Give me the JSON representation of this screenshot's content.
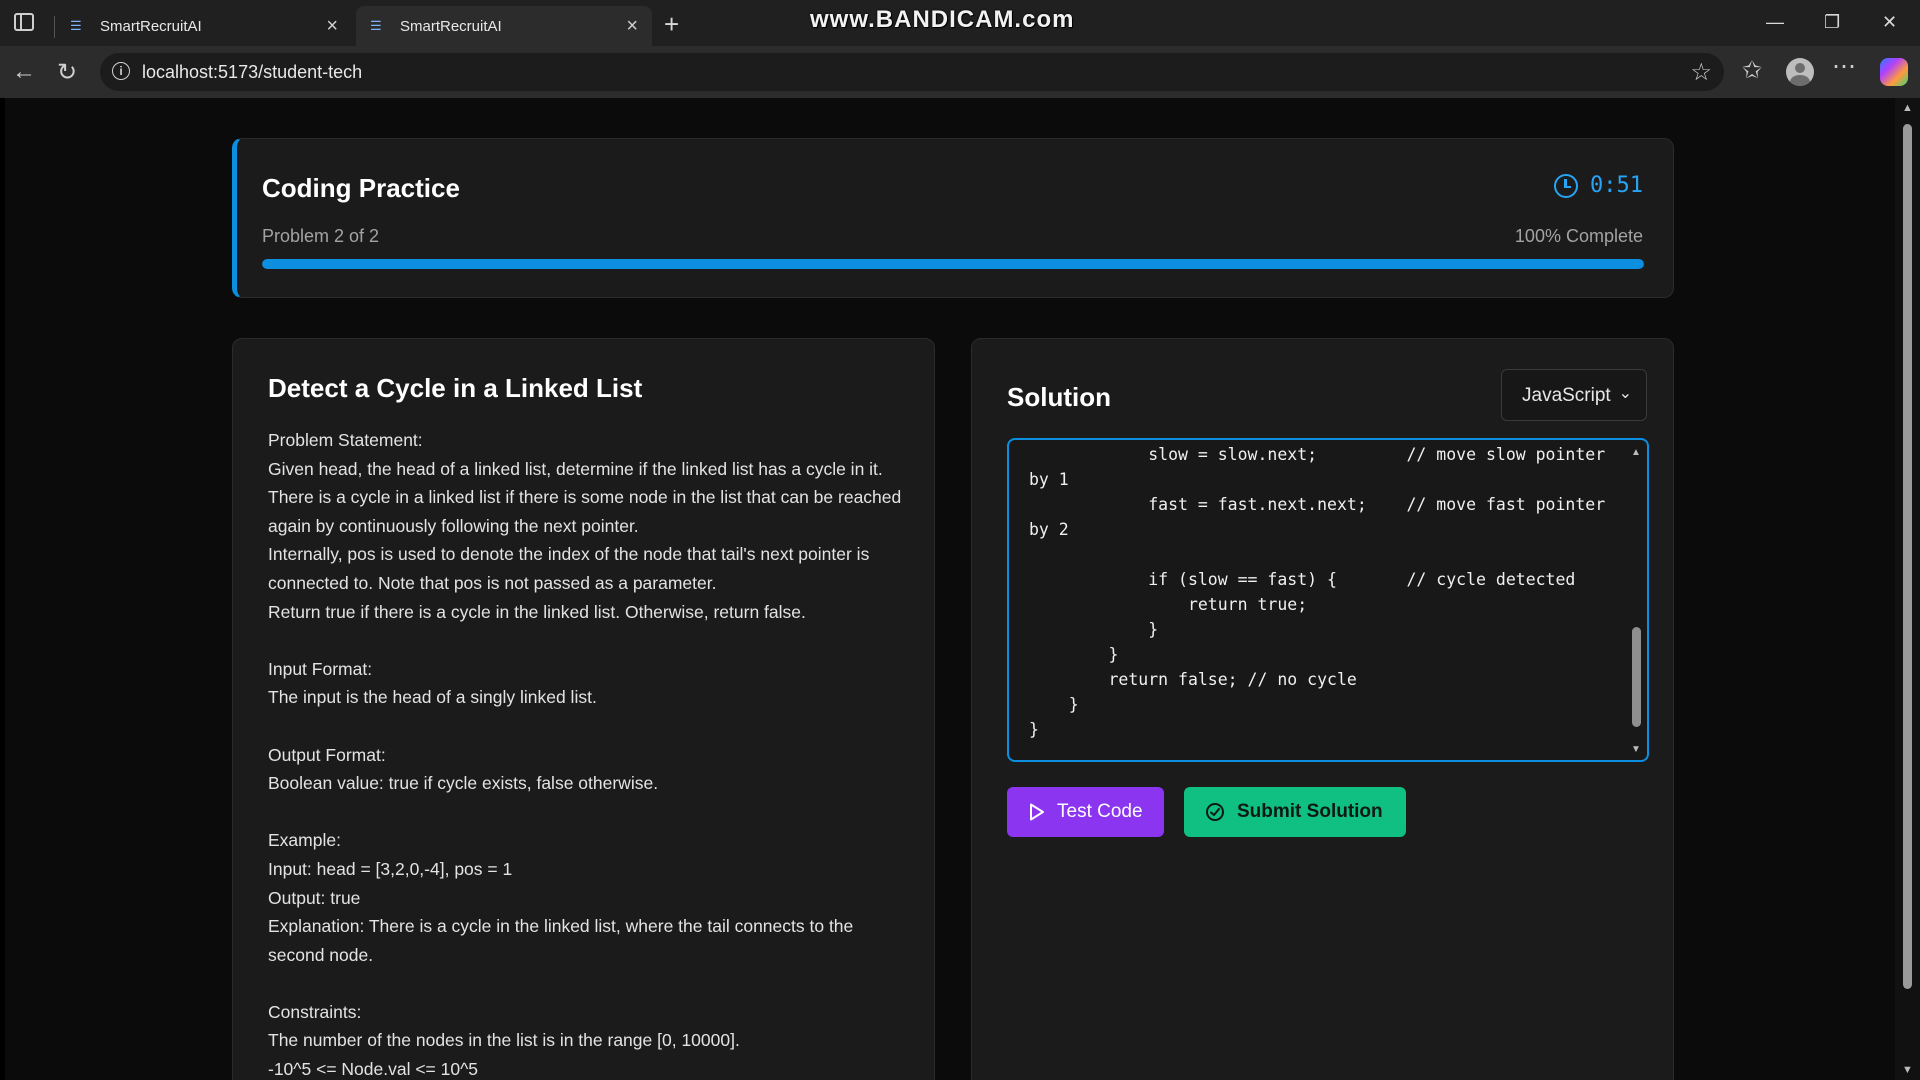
{
  "browser": {
    "tabs": [
      {
        "title": "SmartRecruitAI"
      },
      {
        "title": "SmartRecruitAI"
      }
    ],
    "url": "localhost:5173/student-tech",
    "watermark": "www.BANDICAM.com"
  },
  "header": {
    "title": "Coding Practice",
    "timer": "0:51",
    "problem_count": "Problem 2 of 2",
    "complete_label": "100% Complete",
    "progress_percent": 100,
    "accent_color": "#0c8fe0"
  },
  "problem": {
    "title": "Detect a Cycle in a Linked List",
    "lines": [
      "Problem Statement:",
      "Given head, the head of a linked list, determine if the linked list has a cycle in it.",
      "There is a cycle in a linked list if there is some node in the list that can be reached again by continuously following the next pointer.",
      "Internally, pos is used to denote the index of the node that tail's next pointer is connected to. Note that pos is not passed as a parameter.",
      "Return true if there is a cycle in the linked list. Otherwise, return false.",
      "",
      "Input Format:",
      "The input is the head of a singly linked list.",
      "",
      "Output Format:",
      "Boolean value: true if cycle exists, false otherwise.",
      "",
      "Example:",
      "Input: head = [3,2,0,-4], pos = 1",
      "Output: true",
      "Explanation: There is a cycle in the linked list, where the tail connects to the second node.",
      "",
      "Constraints:",
      "The number of the nodes in the list is in the range [0, 10000].",
      "-10^5 <= Node.val <= 10^5"
    ]
  },
  "solution": {
    "title": "Solution",
    "language": "JavaScript",
    "code": "            slow = slow.next;         // move slow pointer\nby 1\n            fast = fast.next.next;    // move fast pointer\nby 2\n\n            if (slow == fast) {       // cycle detected\n                return true;\n            }\n        }\n        return false; // no cycle\n    }\n}",
    "test_label": "Test Code",
    "submit_label": "Submit Solution",
    "test_color": "#8b35f0",
    "submit_color": "#10bf82"
  }
}
